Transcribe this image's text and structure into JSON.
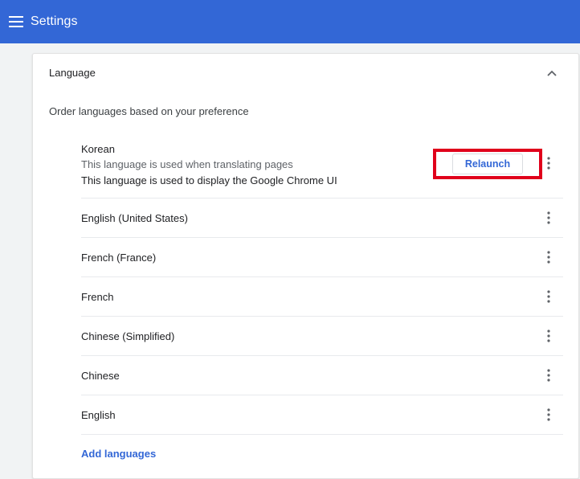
{
  "header": {
    "title": "Settings",
    "menu_icon": "hamburger-menu-icon",
    "background_color": "#3367d6"
  },
  "language_section": {
    "title": "Language",
    "collapse_icon": "chevron-up-icon",
    "order_label": "Order languages based on your preference",
    "languages": [
      {
        "name": "Korean",
        "detail_translate": "This language is used when translating pages",
        "detail_ui": "This language is used to display the Google Chrome UI",
        "action_label": "Relaunch"
      },
      {
        "name": "English (United States)"
      },
      {
        "name": "French (France)"
      },
      {
        "name": "French"
      },
      {
        "name": "Chinese (Simplified)"
      },
      {
        "name": "Chinese"
      },
      {
        "name": "English"
      }
    ],
    "more_icon": "more-vert-icon",
    "add_languages_label": "Add languages"
  },
  "colors": {
    "accent": "#3367d6",
    "highlight": "#e0001b"
  }
}
